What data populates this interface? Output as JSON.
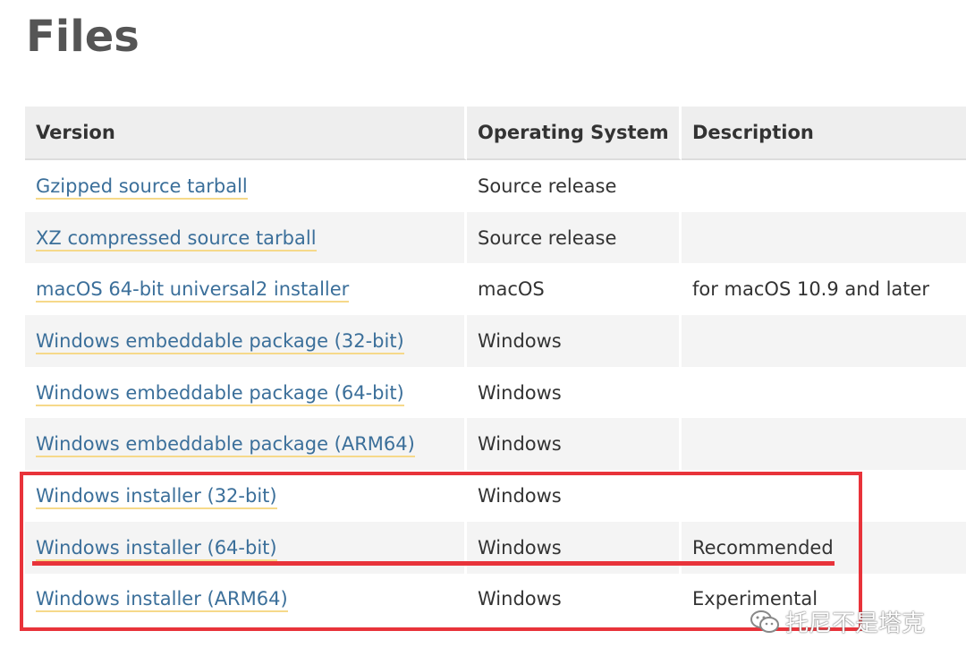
{
  "page": {
    "title": "Files"
  },
  "table": {
    "headers": [
      "Version",
      "Operating System",
      "Description"
    ],
    "rows": [
      {
        "version": "Gzipped source tarball",
        "os": "Source release",
        "description": ""
      },
      {
        "version": "XZ compressed source tarball",
        "os": "Source release",
        "description": ""
      },
      {
        "version": "macOS 64-bit universal2 installer",
        "os": "macOS",
        "description": "for macOS 10.9 and later"
      },
      {
        "version": "Windows embeddable package (32-bit)",
        "os": "Windows",
        "description": ""
      },
      {
        "version": "Windows embeddable package (64-bit)",
        "os": "Windows",
        "description": ""
      },
      {
        "version": "Windows embeddable package (ARM64)",
        "os": "Windows",
        "description": ""
      },
      {
        "version": "Windows installer (32-bit)",
        "os": "Windows",
        "description": ""
      },
      {
        "version": "Windows installer (64-bit)",
        "os": "Windows",
        "description": "Recommended"
      },
      {
        "version": "Windows installer (ARM64)",
        "os": "Windows",
        "description": "Experimental"
      }
    ]
  },
  "annotation": {
    "color": "#e8333a"
  },
  "watermark": {
    "text": "托尼不是塔克",
    "icon": "wechat-icon"
  },
  "colors": {
    "link": "#3b6f9a",
    "link_underline": "#f6d98a",
    "header_bg": "#eeeeee"
  }
}
